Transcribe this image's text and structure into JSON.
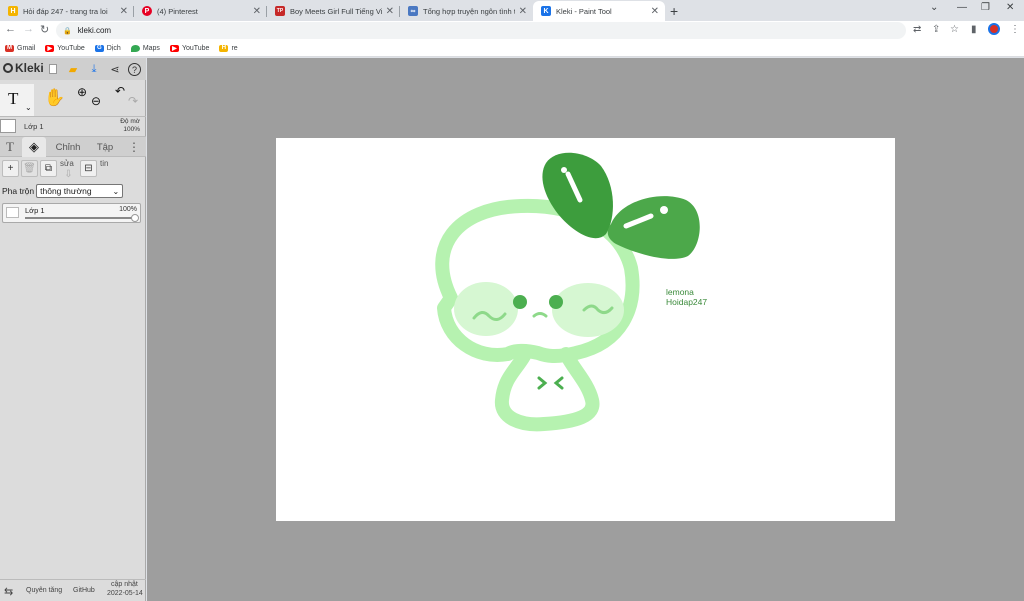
{
  "browser": {
    "tabs": [
      {
        "title": "Hỏi đáp 247 - trang tra loi",
        "favicon_color": "#f4b400",
        "favicon_glyph": "H"
      },
      {
        "title": "(4) Pinterest",
        "favicon_color": "#e60023",
        "favicon_glyph": "P"
      },
      {
        "title": "Boy Meets Girl Full Tiếng Việt Bả",
        "favicon_color": "#c62828",
        "favicon_glyph": "TP"
      },
      {
        "title": "Tổng hợp truyện ngôn tình tổng",
        "favicon_color": "#4a78c2",
        "favicon_glyph": "∞"
      },
      {
        "title": "Kleki - Paint Tool",
        "favicon_color": "#1a73e8",
        "favicon_glyph": "K"
      }
    ],
    "url": "kleki.com",
    "bookmarks": [
      {
        "label": "Gmail",
        "color": "#d93025",
        "glyph": "M"
      },
      {
        "label": "YouTube",
        "color": "#ff0000",
        "glyph": "▶"
      },
      {
        "label": "Dịch",
        "color": "#1a73e8",
        "glyph": "G"
      },
      {
        "label": "Maps",
        "color": "#34a853",
        "glyph": "●"
      },
      {
        "label": "YouTube",
        "color": "#ff0000",
        "glyph": "▶"
      },
      {
        "label": "re",
        "color": "#f4b400",
        "glyph": "H"
      }
    ]
  },
  "kleki": {
    "logo": "Kleki",
    "layer_header": {
      "name": "Lớp 1",
      "opacity_label": "Độ mờ",
      "opacity_value": "100%"
    },
    "tabs": [
      "Chỉnh",
      "Tập"
    ],
    "actions": {
      "edit_label": "sửa",
      "info_label": "tin"
    },
    "blend": {
      "label": "Pha trộn",
      "value": "thông thường"
    },
    "layer": {
      "name": "Lớp 1",
      "opacity": "100%"
    },
    "footer": {
      "layers": "Quyên tăng",
      "github": "GitHub",
      "update_label": "cập nhật",
      "update_date": "2022-05-14"
    }
  },
  "canvas": {
    "text_line1": "lemona",
    "text_line2": "Hoidap247",
    "colors": {
      "light_green": "#b6f2b0",
      "mid_green": "#4caf50",
      "dark_green": "#3d9d3d"
    }
  }
}
